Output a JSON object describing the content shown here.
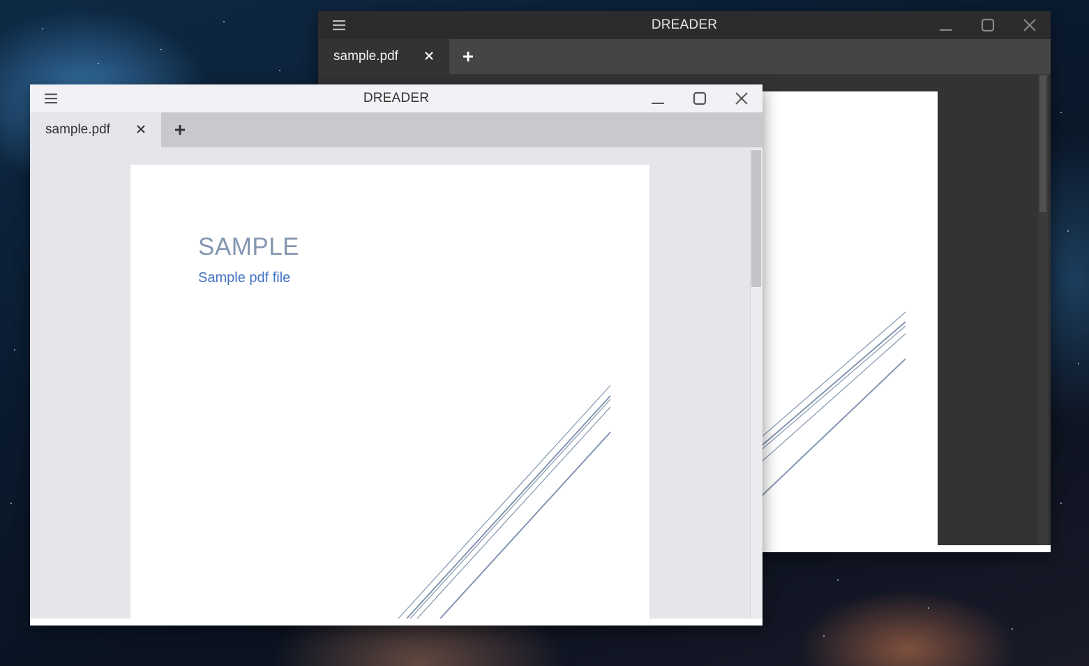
{
  "background_windows": {
    "app_title": "DREADER",
    "tab": {
      "label": "sample.pdf"
    }
  },
  "foreground_window": {
    "app_title": "DREADER",
    "tab": {
      "label": "sample.pdf"
    },
    "document": {
      "title": "SAMPLE",
      "subtitle": "Sample pdf file"
    }
  },
  "icons": {
    "menu": "hamburger-icon",
    "minimize": "minimize-icon",
    "maximize": "maximize-icon",
    "close": "close-icon",
    "tab_close": "close-icon",
    "new_tab": "plus-icon"
  },
  "colors": {
    "dark_titlebar": "#2c2c2e",
    "dark_tabbar": "#454547",
    "light_titlebar": "#f2f2f6",
    "light_tabbar": "#c8c8cd",
    "doc_title": "#8496b0",
    "doc_subtitle": "#4472c4",
    "decor_lines": "#8496b0"
  }
}
